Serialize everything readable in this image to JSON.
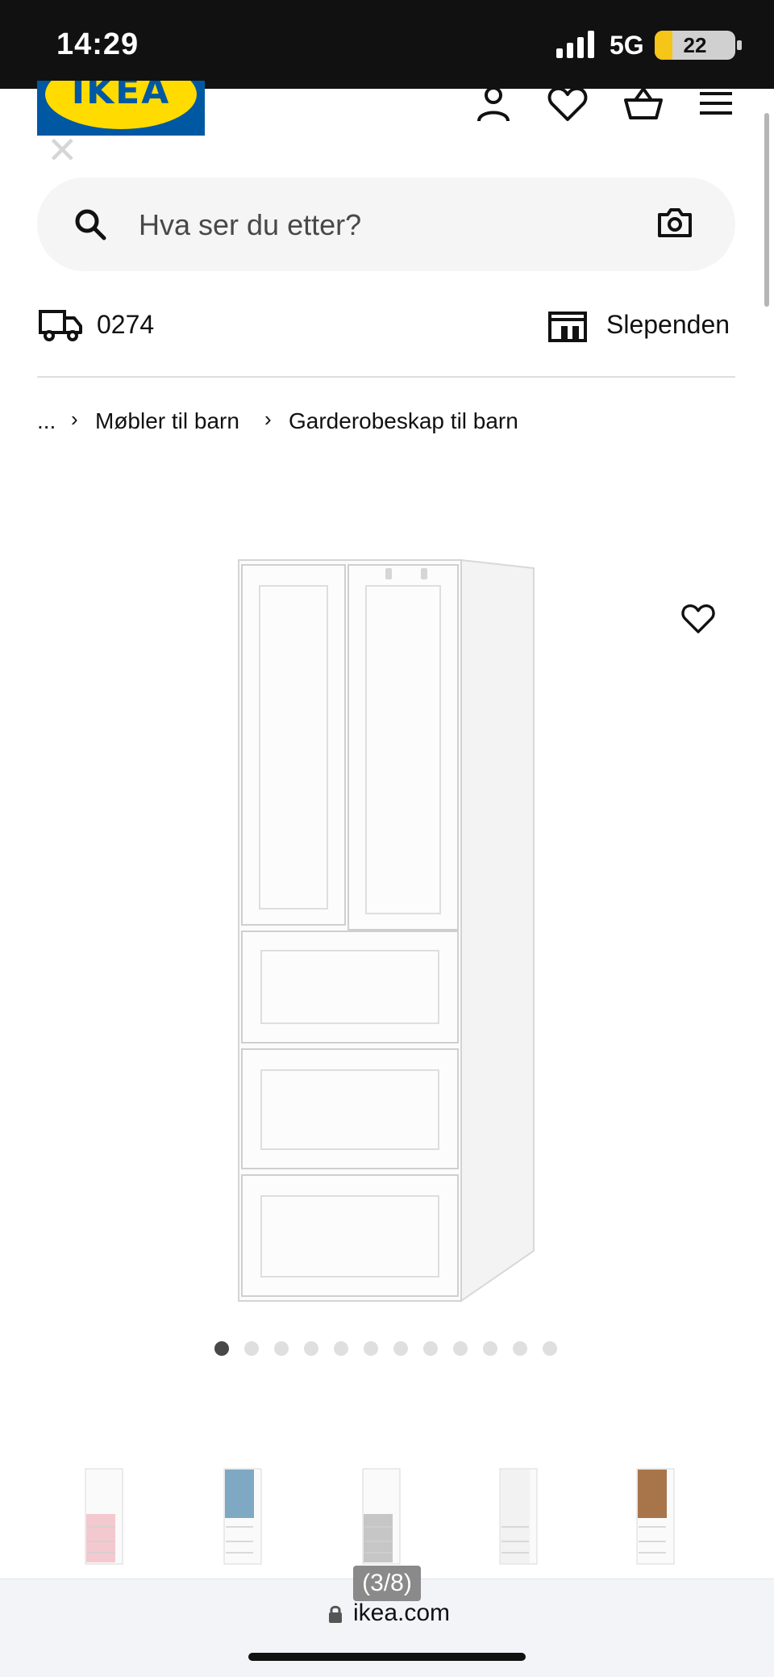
{
  "status_bar": {
    "time": "14:29",
    "network": "5G",
    "battery": "22",
    "battery_fraction": 0.22
  },
  "header": {
    "logo_text": "IKEA",
    "icons": [
      "person-icon",
      "heart-icon",
      "basket-icon",
      "menu-icon"
    ]
  },
  "search": {
    "placeholder": "Hva ser du etter?"
  },
  "delivery": {
    "postcode": "0274",
    "store": "Slependen"
  },
  "breadcrumb": {
    "ellipsis": "...",
    "items": [
      "Møbler til barn",
      "Garderobeskap til barn"
    ]
  },
  "carousel": {
    "total": 12,
    "active_index": 0
  },
  "variants": [
    {
      "name": "pink",
      "accent": "#f3c9cf"
    },
    {
      "name": "blue",
      "accent": "#7fa8c3"
    },
    {
      "name": "grey",
      "accent": "#c6c6c6"
    },
    {
      "name": "white",
      "accent": "#f2f2f2"
    },
    {
      "name": "wood",
      "accent": "#a8754a"
    }
  ],
  "browser": {
    "pager": "(3/8)",
    "url": "ikea.com"
  },
  "colors": {
    "brand_blue": "#0058a3",
    "brand_yellow": "#ffdb00"
  }
}
